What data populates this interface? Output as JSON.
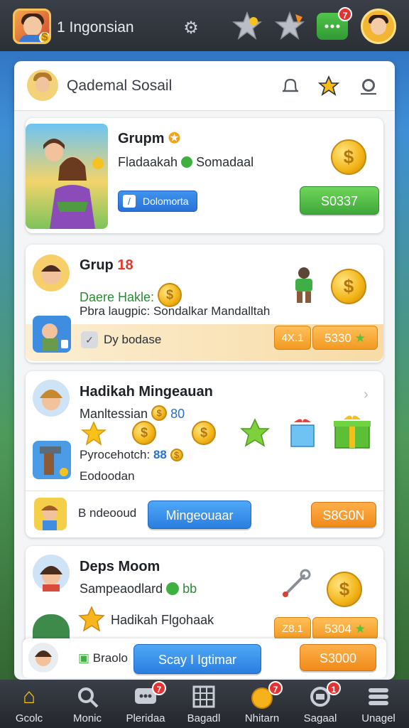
{
  "topbar": {
    "title": "1 Ingonsian",
    "chat_badge": "7"
  },
  "panel": {
    "title": "Qademal Sosail"
  },
  "cards": [
    {
      "title": "Grupm",
      "line1": "Fladaakah",
      "line1b": "Somadaal",
      "chip": "Dolomorta",
      "button": "S0337"
    },
    {
      "title": "Grup",
      "title_num": "18",
      "line1": "Daere Hakle:",
      "line2": "Pbra laugpic: Sondalkar Mandalltah",
      "strip_text": "Dy bodase",
      "pill_small": "4X.1",
      "pill_main": "5330"
    },
    {
      "title": "Hadikah Mingeauan",
      "line1": "Manltessian",
      "line1_num": "80",
      "line2": "Pyrocehotch:",
      "line2_num": "88",
      "line3": "Eodoodan",
      "strip_text": "B ndeooud",
      "button_blue": "Mingeouaar",
      "button_orange": "S8G0N"
    },
    {
      "title": "Deps Moom",
      "line1": "Sampeaodlard",
      "line1_num": "bb",
      "line2": "Hadikah Flgohaak",
      "pill_small": "Z8.1",
      "pill_main": "5304"
    }
  ],
  "footer_row": {
    "label": "Braolo",
    "button_blue": "Scay I Igtimar",
    "button_orange": "S3000"
  },
  "bottom_nav": [
    {
      "label": "Gcolc",
      "icon": "home-icon"
    },
    {
      "label": "Monic",
      "icon": "search-icon"
    },
    {
      "label": "Pleridaa",
      "icon": "chat-icon",
      "badge": "7"
    },
    {
      "label": "Bagadl",
      "icon": "grid-icon"
    },
    {
      "label": "Nhitarn",
      "icon": "coin-icon",
      "badge": "7"
    },
    {
      "label": "Sagaal",
      "icon": "message-icon",
      "badge": "1"
    },
    {
      "label": "Unagel",
      "icon": "menu-icon"
    }
  ]
}
